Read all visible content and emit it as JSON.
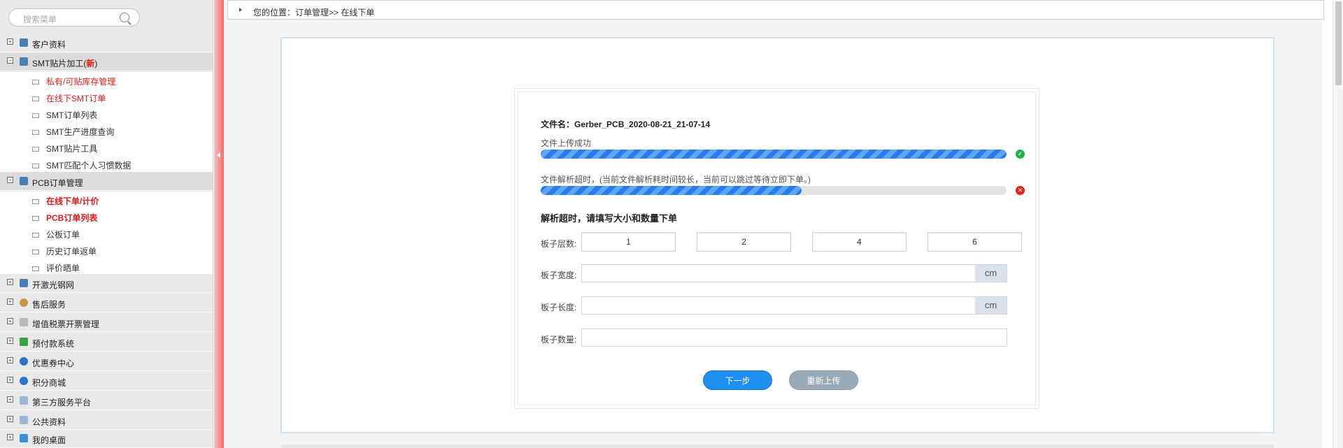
{
  "sidebar": {
    "search_placeholder": "搜索菜单",
    "groups": [
      {
        "label": "客户资料",
        "icon": "user-card-icon",
        "expanded": false
      },
      {
        "label": "SMT贴片加工",
        "badge_open": "(",
        "badge": "新",
        "badge_close": ")",
        "icon": "grid-icon",
        "expanded": true
      },
      {
        "label": "PCB订单管理",
        "icon": "grid-icon",
        "expanded": true
      },
      {
        "label": "开激光钢网",
        "icon": "grid-icon",
        "expanded": false
      },
      {
        "label": "售后服务",
        "icon": "person-icon",
        "expanded": false
      },
      {
        "label": "增值税票开票管理",
        "icon": "invoice-icon",
        "expanded": false
      },
      {
        "label": "预付款系统",
        "icon": "money-icon",
        "expanded": false
      },
      {
        "label": "优惠券中心",
        "icon": "shield-icon",
        "expanded": false
      },
      {
        "label": "积分商城",
        "icon": "shield-icon",
        "expanded": false
      },
      {
        "label": "第三方服务平台",
        "icon": "window-icon",
        "expanded": false
      },
      {
        "label": "公共资料",
        "icon": "window-icon",
        "expanded": false
      },
      {
        "label": "我的桌面",
        "icon": "chat-icon",
        "expanded": false
      }
    ],
    "smt_items": [
      {
        "label": "私有/可贴库存管理",
        "style": "red"
      },
      {
        "label": "在线下SMT订单",
        "style": "red"
      },
      {
        "label": "SMT订单列表",
        "style": "normal"
      },
      {
        "label": "SMT生产进度查询",
        "style": "normal"
      },
      {
        "label": "SMT贴片工具",
        "style": "normal"
      },
      {
        "label": "SMT匹配个人习惯数据",
        "style": "normal"
      }
    ],
    "pcb_items": [
      {
        "label": "在线下单/计价",
        "style": "red-bold"
      },
      {
        "label": "PCB订单列表",
        "style": "red-bold"
      },
      {
        "label": "公板订单",
        "style": "normal"
      },
      {
        "label": "历史订单返单",
        "style": "normal"
      },
      {
        "label": "评价晒单",
        "style": "normal"
      }
    ]
  },
  "breadcrumb": {
    "text": "您的位置：订单管理>> 在线下单"
  },
  "upload": {
    "filename_label": "文件名：",
    "filename": "Gerber_PCB_2020-08-21_21-07-14",
    "upload_status": "文件上传成功",
    "upload_progress": 1.0,
    "parse_status": "文件解析超时，(当前文件解析耗时间较长，当前可以跳过等待立即下单。)",
    "parse_progress": 0.56,
    "section_title": "解析超时，请填写大小和数量下单",
    "layers_label": "板子层数:",
    "layer_options": [
      "1",
      "2",
      "4",
      "6"
    ],
    "width_label": "板子宽度:",
    "width_value": "",
    "width_unit": "cm",
    "length_label": "板子长度:",
    "length_value": "",
    "length_unit": "cm",
    "quantity_label": "板子数量:",
    "quantity_value": "",
    "next_button": "下一步",
    "reupload_button": "重新上传"
  },
  "colors": {
    "accent_red": "#e21b1b",
    "progress_blue": "#2a7de8",
    "success_green": "#24b14b",
    "error_red": "#e5221c",
    "primary_button": "#1e8ff0",
    "secondary_button": "#9aa9b8"
  }
}
